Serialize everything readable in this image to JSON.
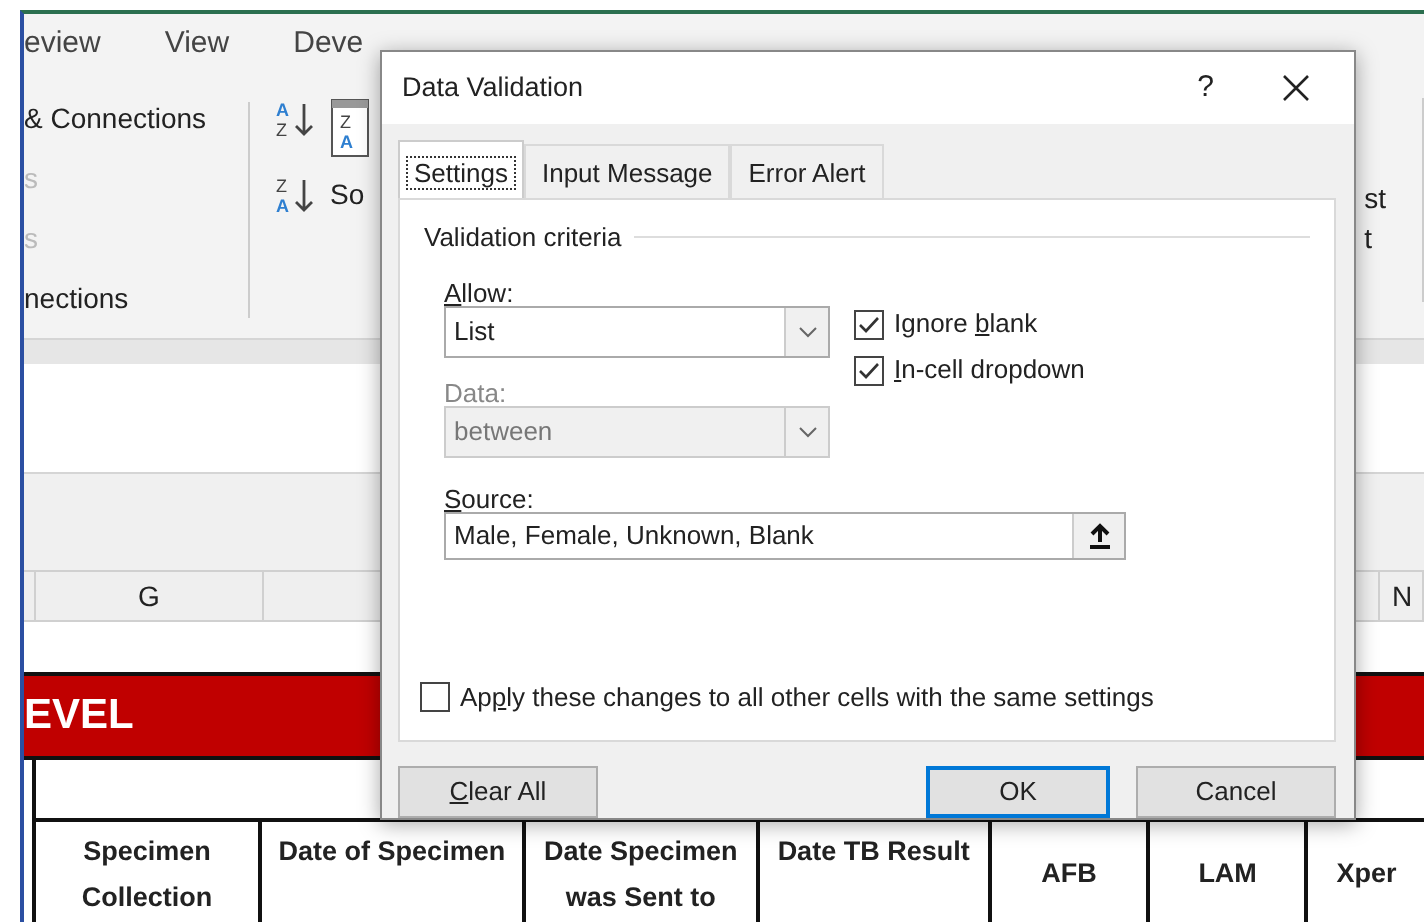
{
  "ribbon": {
    "tabs": [
      {
        "label": "eview",
        "selected": false
      },
      {
        "label": "View",
        "selected": false
      },
      {
        "label": "Deve",
        "selected": false
      }
    ],
    "connections": {
      "items": [
        {
          "label": "& Connections",
          "disabled": false
        },
        {
          "label": "s",
          "disabled": true
        },
        {
          "label": "s",
          "disabled": true
        }
      ],
      "group_label": "nections"
    },
    "sort": {
      "label": "So",
      "ascending_icon": [
        "A",
        "Z"
      ],
      "descending_icon": [
        "Z",
        "A"
      ],
      "sort_icon": [
        "Z",
        "A"
      ]
    },
    "right_items": [
      "st",
      "t"
    ]
  },
  "columns": [
    "G",
    "N"
  ],
  "banner": "EVEL",
  "table": {
    "headers": [
      "Specimen Collection",
      "Date of Specimen",
      "Date Specimen was Sent to",
      "Date TB Result",
      "AFB",
      "LAM",
      "Xper"
    ]
  },
  "dialog": {
    "title": "Data Validation",
    "help": "?",
    "tabs": [
      {
        "label": "Settings",
        "selected": true
      },
      {
        "label": "Input Message",
        "selected": false
      },
      {
        "label": "Error Alert",
        "selected": false
      }
    ],
    "section": "Validation criteria",
    "allow": {
      "label": {
        "key": "A",
        "post": "llow:"
      },
      "value": "List",
      "disabled": false
    },
    "data": {
      "label": {
        "post": "Data:"
      },
      "value": "between",
      "disabled": true
    },
    "checks": [
      {
        "label": {
          "pre": "Ignore ",
          "key": "b",
          "post": "lank"
        },
        "checked": true
      },
      {
        "label": {
          "key": "I",
          "post": "n-cell dropdown"
        },
        "checked": true
      }
    ],
    "source": {
      "label": {
        "key": "S",
        "post": "ource:"
      },
      "value": "Male, Female, Unknown, Blank"
    },
    "apply": {
      "label": {
        "pre": "Ap",
        "key": "p",
        "post": "ly these changes to all other cells with the same settings"
      },
      "checked": false
    },
    "buttons": [
      {
        "label": {
          "key": "C",
          "post": "lear All"
        },
        "kind": "plain"
      },
      {
        "label": {
          "post": "OK"
        },
        "kind": "default"
      },
      {
        "label": {
          "post": "Cancel"
        },
        "kind": "plain"
      }
    ]
  }
}
